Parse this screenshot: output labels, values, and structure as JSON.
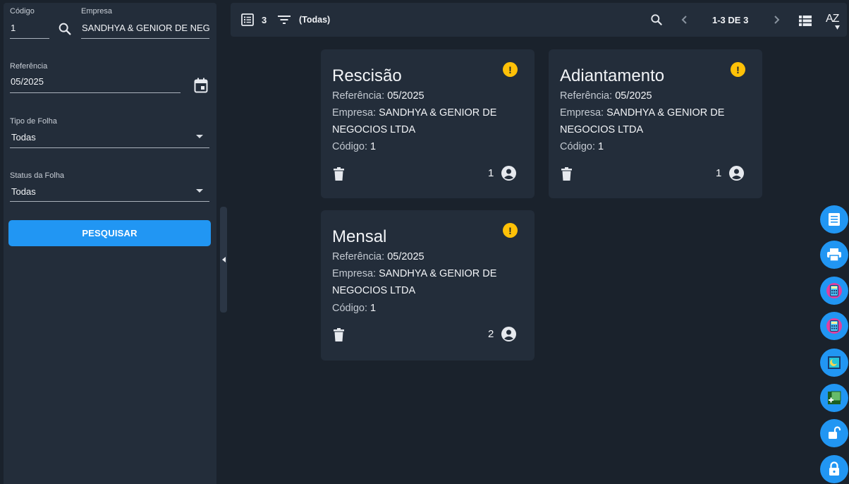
{
  "filters": {
    "codigo_label": "Código",
    "codigo_value": "1",
    "empresa_label": "Empresa",
    "empresa_value": "SANDHYA & GENIOR DE NEGO",
    "referencia_label": "Referência",
    "referencia_value": "05/2025",
    "tipo_label": "Tipo de Folha",
    "tipo_value": "Todas",
    "status_label": "Status da Folha",
    "status_value": "Todas",
    "search_button": "PESQUISAR"
  },
  "toolbar": {
    "list_count": "3",
    "filter_text": "(Todas)",
    "pagination": "1-3 DE 3",
    "sort_label": "AZ"
  },
  "cards": [
    {
      "title": "Rescisão",
      "ref_label": "Referência:",
      "ref_value": "05/2025",
      "emp_label": "Empresa:",
      "emp_value": "SANDHYA & GENIOR DE NEGOCIOS LTDA",
      "cod_label": "Código:",
      "cod_value": "1",
      "count": "1"
    },
    {
      "title": "Adiantamento",
      "ref_label": "Referência:",
      "ref_value": "05/2025",
      "emp_label": "Empresa:",
      "emp_value": "SANDHYA & GENIOR DE NEGOCIOS LTDA",
      "cod_label": "Código:",
      "cod_value": "1",
      "count": "1"
    },
    {
      "title": "Mensal",
      "ref_label": "Referência:",
      "ref_value": "05/2025",
      "emp_label": "Empresa:",
      "emp_value": "SANDHYA & GENIOR DE NEGOCIOS LTDA",
      "cod_label": "Código:",
      "cod_value": "1",
      "count": "2"
    }
  ],
  "fab_icons": [
    "receipt-icon",
    "print-icon",
    "calculator-icon",
    "calculator-icon",
    "moon-icon",
    "add-box-icon",
    "lock-open-icon",
    "lock-icon"
  ],
  "colors": {
    "accent": "#2196f3",
    "warning": "#ffc107",
    "panel": "#232d3a",
    "background": "#1a222c"
  }
}
